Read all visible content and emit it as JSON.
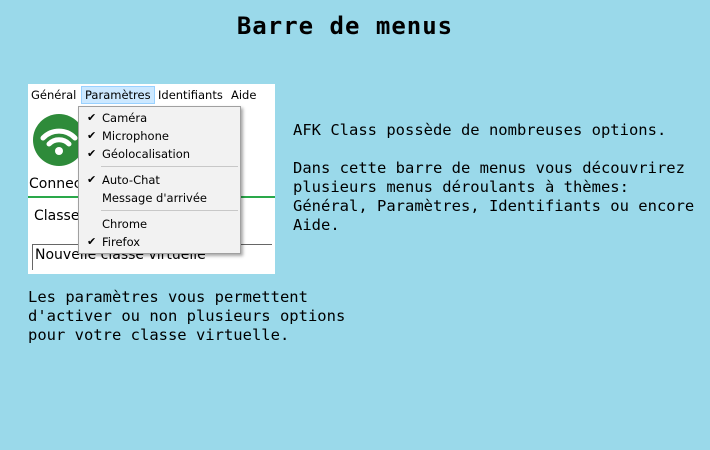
{
  "page_title": "Barre de menus",
  "screenshot": {
    "menubar": [
      {
        "label": "Général",
        "active": false
      },
      {
        "label": "Paramètres",
        "active": true
      },
      {
        "label": "Identifiants",
        "active": false
      },
      {
        "label": "Aide",
        "active": false
      }
    ],
    "dropdown": {
      "group1": [
        {
          "label": "Caméra",
          "checked": true
        },
        {
          "label": "Microphone",
          "checked": true
        },
        {
          "label": "Géolocalisation",
          "checked": true
        }
      ],
      "group2": [
        {
          "label": "Auto-Chat",
          "checked": true
        },
        {
          "label": "Message d'arrivée",
          "checked": false
        }
      ],
      "group3": [
        {
          "label": "Chrome",
          "checked": false
        },
        {
          "label": "Firefox",
          "checked": true
        }
      ]
    },
    "connect_text": "Connec",
    "classe_label": "Classe",
    "class_field_value": "Nouvelle classe virtuelle",
    "logo_icon": "wifi-icon",
    "logo_color": "#2e8b3a",
    "accent_line_color": "#2aa84a",
    "active_menu_color": "#cce8ff"
  },
  "description": {
    "paragraph1": "AFK Class possède de nombreuses options.",
    "paragraph2": "Dans cette barre de menus vous découvrirez plusieurs menus déroulants à thèmes: Général, Paramètres, Identifiants ou encore Aide."
  },
  "bottom_text": "Les paramètres vous permettent d'activer ou non plusieurs options pour votre classe virtuelle.",
  "background_color": "#9ad9ea"
}
